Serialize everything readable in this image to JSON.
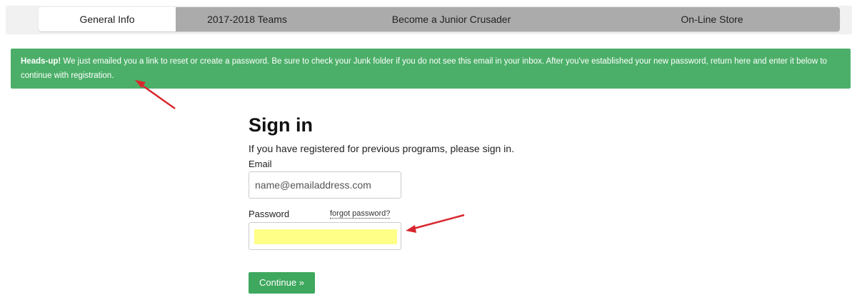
{
  "tabs": [
    {
      "label": "General Info"
    },
    {
      "label": "2017-2018 Teams"
    },
    {
      "label": "Become a Junior Crusader"
    },
    {
      "label": "On-Line Store"
    }
  ],
  "alert": {
    "bold": "Heads-up!",
    "message": " We just emailed you a link to reset or create a password. Be sure to check your Junk folder if you do not see this email in your inbox. After you've established your new password, return here and enter it below to continue with registration.",
    "color": "#4caf69"
  },
  "signin": {
    "title": "Sign in",
    "subtitle": "If you have registered for previous programs, please sign in.",
    "email_label": "Email",
    "email_placeholder": "name@emailaddress.com",
    "password_label": "Password",
    "forgot_label": "forgot password?",
    "continue_label": "Continue »"
  },
  "colors": {
    "accent": "#3ea85e",
    "highlight": "#ffff88",
    "arrow": "#d9262e"
  }
}
